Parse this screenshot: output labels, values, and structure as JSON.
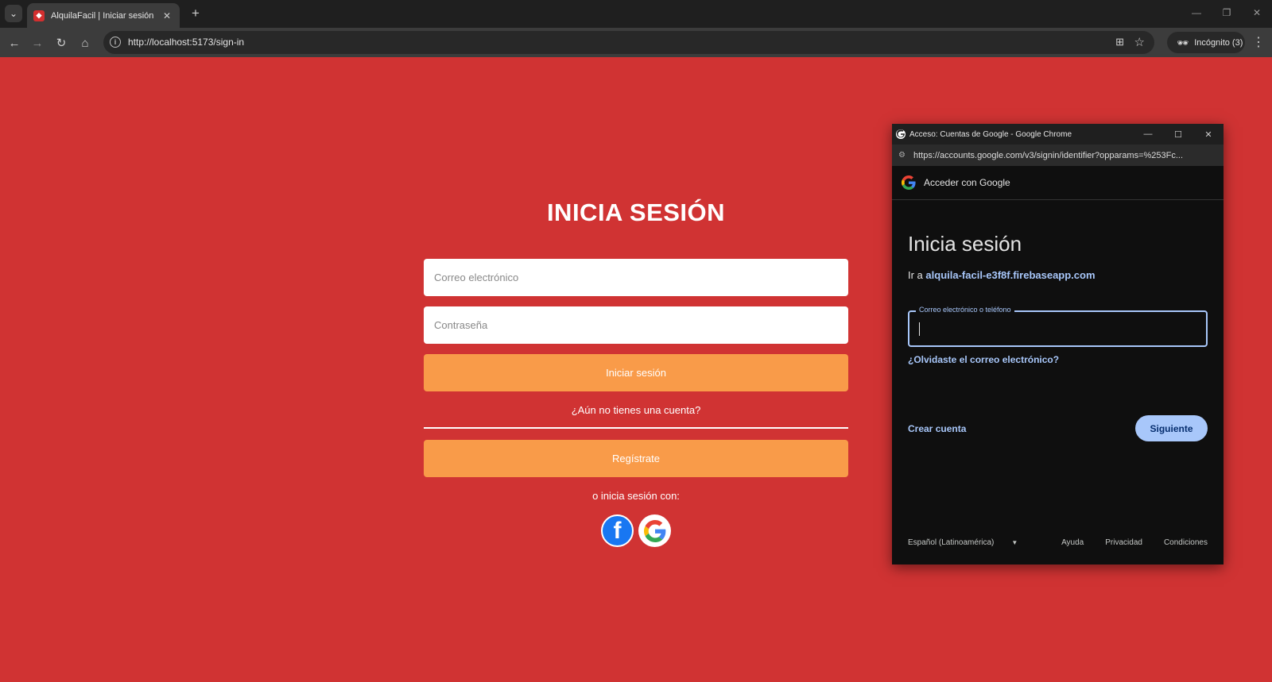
{
  "browser": {
    "tab_title": "AlquilaFacil | Iniciar sesión",
    "tab_close": "✕",
    "new_tab": "+",
    "url": "http://localhost:5173/sign-in",
    "incognito_label": "Incógnito (3)",
    "window_controls": [
      "—",
      "❐",
      "✕"
    ]
  },
  "signin": {
    "title": "INICIA SESIÓN",
    "email_placeholder": "Correo electrónico",
    "password_placeholder": "Contraseña",
    "login_button": "Iniciar sesión",
    "no_account": "¿Aún no tienes una cuenta?",
    "register_button": "Regístrate",
    "social_text": "o inicia sesión con:"
  },
  "popup": {
    "window_title": "Acceso: Cuentas de Google - Google Chrome",
    "url": "https://accounts.google.com/v3/signin/identifier?opparams=%253Fc...",
    "header": "Acceder con Google",
    "heading": "Inicia sesión",
    "goto_prefix": "Ir a ",
    "goto_domain": "alquila-facil-e3f8f.firebaseapp.com",
    "input_label": "Correo electrónico o teléfono",
    "forgot": "¿Olvidaste el correo electrónico?",
    "create_account": "Crear cuenta",
    "next": "Siguiente",
    "language": "Español (Latinoamérica)",
    "footer_links": [
      "Ayuda",
      "Privacidad",
      "Condiciones"
    ]
  },
  "icons": {
    "facebook": "facebook-icon",
    "google": "google-icon"
  },
  "colors": {
    "page_bg": "#d03333",
    "orange": "#f99b49",
    "popup_accent": "#a8c7fa"
  }
}
